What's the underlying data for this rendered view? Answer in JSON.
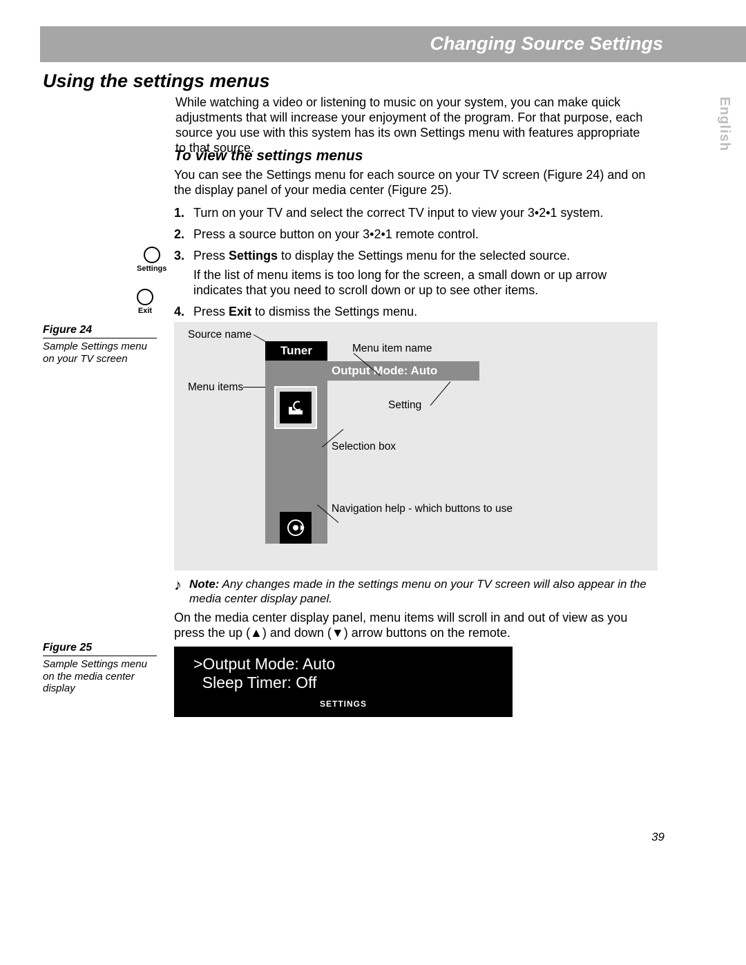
{
  "header": {
    "section_title": "Changing Source Settings"
  },
  "language_tab": "English",
  "main_heading": "Using the settings menus",
  "intro": "While watching a video or listening to music on your system, you can make quick adjustments that will increase your enjoyment of the program. For that purpose, each source you use with this system has its own Settings menu with features appropriate to that source.",
  "sub_heading": "To view the settings menus",
  "sub_para": "You can see the Settings menu for each source on your TV screen (Figure 24) and on the display panel of your media center (Figure 25).",
  "steps": [
    {
      "num": "1.",
      "text_before": "Turn on your TV and select the correct TV input to view your 3•2•1 system.",
      "bold": "",
      "text_after": ""
    },
    {
      "num": "2.",
      "text_before": "Press a source button on your 3•2•1 remote control.",
      "bold": "",
      "text_after": ""
    },
    {
      "num": "3.",
      "text_before": "Press ",
      "bold": "Settings",
      "text_after": " to display the Settings menu for the selected source."
    },
    {
      "num": "4.",
      "text_before": "Press ",
      "bold": "Exit",
      "text_after": " to dismiss the Settings menu."
    }
  ],
  "step3_extra": "If the list of menu items is too long for the screen, a small down or up arrow indicates that you need to scroll down or up to see other items.",
  "remote_buttons": {
    "settings": "Settings",
    "exit": "Exit"
  },
  "fig24": {
    "label": "Figure 24",
    "caption": "Sample Settings menu on your TV screen",
    "source_name_lab": "Source name",
    "menu_item_name_lab": "Menu item name",
    "menu_items_lab": "Menu items",
    "setting_lab": "Setting",
    "selection_box_lab": "Selection box",
    "nav_help_lab": "Navigation help - which buttons to use",
    "tuner": "Tuner",
    "output_mode": "Output Mode: Auto"
  },
  "note": {
    "label": "Note:",
    "text": " Any changes made in the settings menu on your TV screen will also appear in the media center display panel."
  },
  "after_note": "On the media center display panel, menu items will scroll in and out of view as you press the up (▲) and down (▼) arrow buttons on the remote.",
  "fig25": {
    "label": "Figure 25",
    "caption": "Sample Settings menu on the media center display",
    "line1": ">Output Mode: Auto",
    "line2": "  Sleep Timer: Off",
    "footer": "SETTINGS"
  },
  "page_number": "39"
}
